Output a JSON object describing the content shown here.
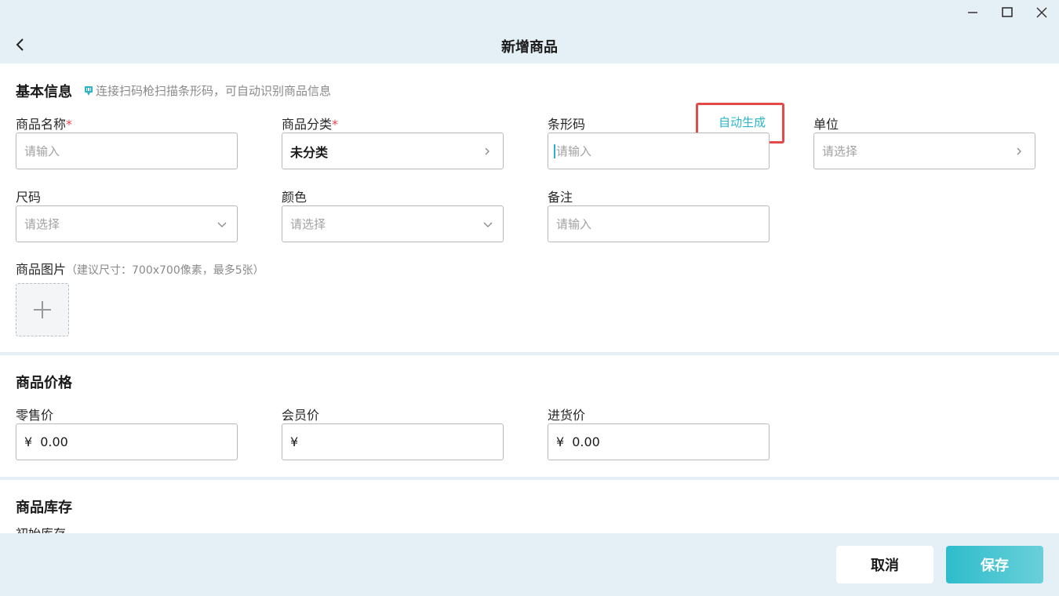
{
  "window": {
    "title": "新增商品",
    "minimize_icon": "minimize-icon",
    "maximize_icon": "maximize-icon",
    "close_icon": "close-icon",
    "back_icon": "chevron-left-icon"
  },
  "basic": {
    "title": "基本信息",
    "scan_hint": "连接扫码枪扫描条形码，可自动识别商品信息",
    "name": {
      "label": "商品名称",
      "required": "*",
      "placeholder": "请输入"
    },
    "category": {
      "label": "商品分类",
      "required": "*",
      "value": "未分类"
    },
    "barcode": {
      "label": "条形码",
      "placeholder": "请输入",
      "auto_generate": "自动生成"
    },
    "unit": {
      "label": "单位",
      "placeholder": "请选择"
    },
    "size": {
      "label": "尺码",
      "placeholder": "请选择"
    },
    "color": {
      "label": "颜色",
      "placeholder": "请选择"
    },
    "remark": {
      "label": "备注",
      "placeholder": "请输入"
    },
    "images": {
      "label": "商品图片",
      "hint": "（建议尺寸：700x700像素，最多5张）"
    }
  },
  "price": {
    "title": "商品价格",
    "retail": {
      "label": "零售价",
      "currency": "¥",
      "value": "0.00"
    },
    "member": {
      "label": "会员价",
      "currency": "¥",
      "value": ""
    },
    "purchase": {
      "label": "进货价",
      "currency": "¥",
      "value": "0.00"
    }
  },
  "stock": {
    "title": "商品库存",
    "partial_label": "初始库存"
  },
  "footer": {
    "cancel_label": "取消",
    "save_label": "保存"
  },
  "colors": {
    "accent": "#2bb5c4",
    "required": "#e5484d",
    "highlight": "#e34a4a",
    "background": "#e5eff6"
  }
}
